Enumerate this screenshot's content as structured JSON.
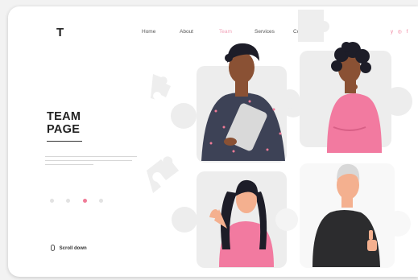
{
  "logo": "T",
  "nav": [
    "Home",
    "About",
    "Team",
    "Services",
    "Contact"
  ],
  "social": [
    "y",
    "◎",
    "f"
  ],
  "hero": {
    "title_line1": "TEAM",
    "title_line2": "PAGE"
  },
  "slider": {
    "dots": 4,
    "active_index": 2
  },
  "scroll_label": "Scroll down",
  "colors": {
    "accent": "#f07b97",
    "accent_soft": "#f2a2b8",
    "puzzle": "#ececec",
    "text": "#222222"
  }
}
